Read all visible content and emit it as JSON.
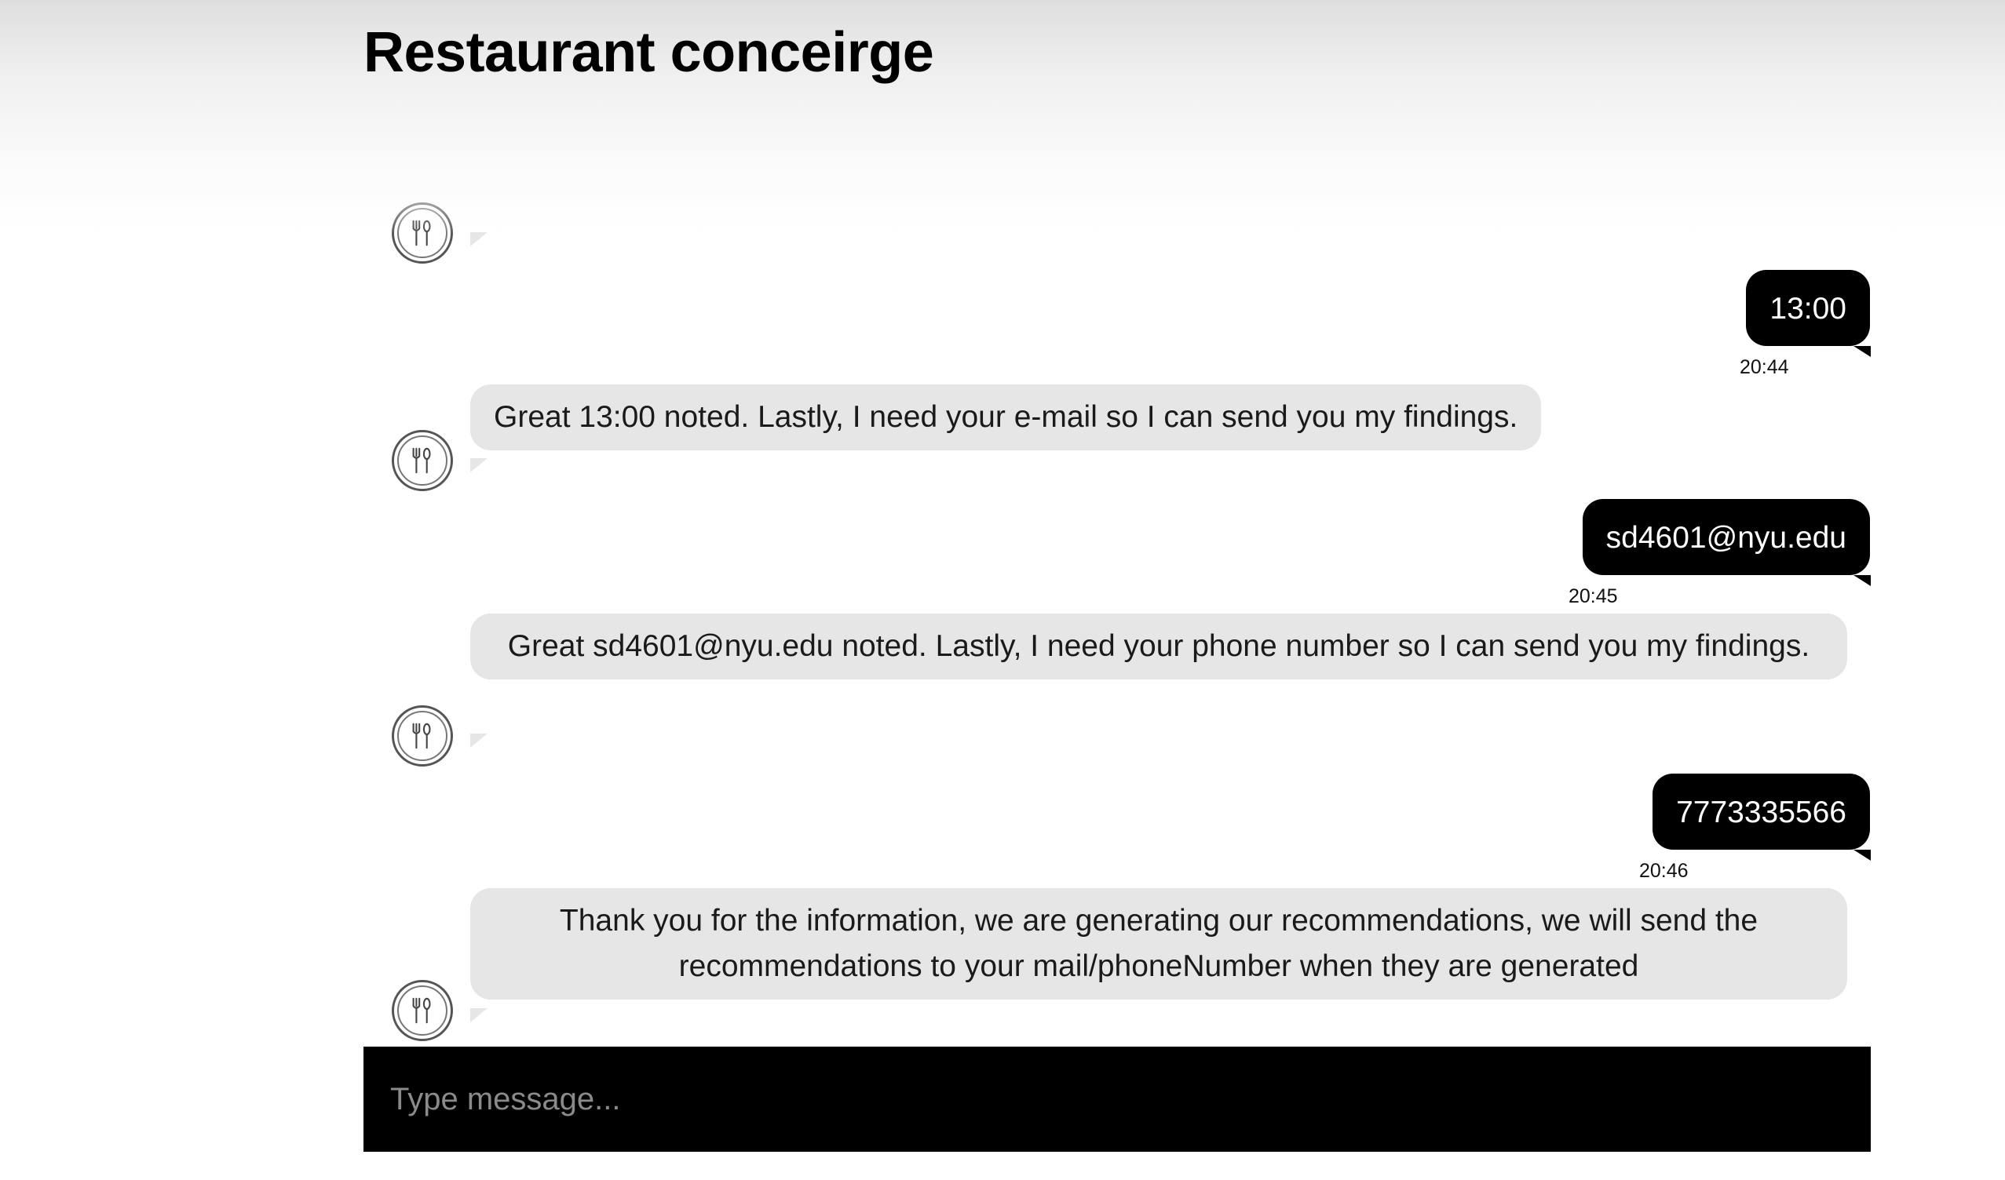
{
  "header": {
    "title": "Restaurant conceirge"
  },
  "messages": [
    {
      "sender": "user",
      "text": "13:00",
      "time": "20:44"
    },
    {
      "sender": "bot",
      "text": "Great 13:00 noted. Lastly, I need your e-mail so I can send you my findings."
    },
    {
      "sender": "user",
      "text": "sd4601@nyu.edu",
      "time": "20:45"
    },
    {
      "sender": "bot",
      "text": "Great sd4601@nyu.edu noted. Lastly, I need your phone number so I can send you my findings."
    },
    {
      "sender": "user",
      "text": "7773335566",
      "time": "20:46"
    },
    {
      "sender": "bot",
      "text": "Thank you for the information, we are generating our recommendations, we will send the recommendations to your mail/phoneNumber when they are generated"
    }
  ],
  "composer": {
    "placeholder": "Type message..."
  },
  "icons": {
    "bot_avatar": "fork-spoon-knife-icon"
  },
  "colors": {
    "user_bubble": "#000000",
    "bot_bubble": "#e6e6e6",
    "input_bar": "#000000"
  }
}
